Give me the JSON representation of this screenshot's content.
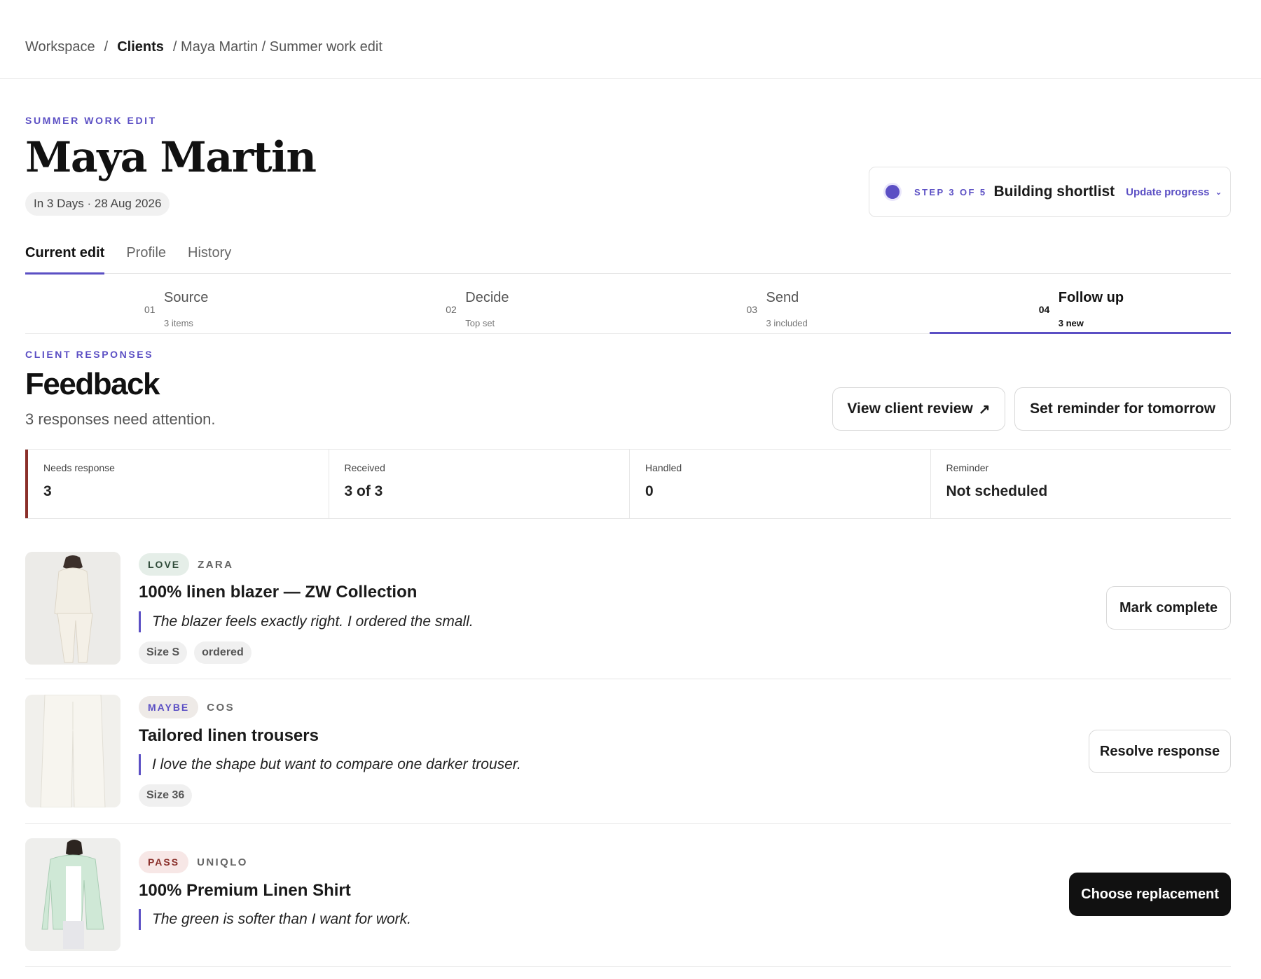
{
  "breadcrumb": {
    "workspace": "Workspace",
    "sep": "/",
    "clients": "Clients",
    "tail": "/ Maya Martin / Summer work edit"
  },
  "header": {
    "eyebrow": "SUMMER WORK EDIT",
    "client_name": "Maya Martin",
    "date_pill": "In 3 Days · 28 Aug 2026"
  },
  "progress": {
    "step_label": "STEP 3 OF 5",
    "title": "Building shortlist",
    "update_label": "Update progress",
    "accent": "#5b4fc4"
  },
  "tabs": [
    {
      "label": "Current edit",
      "active": true
    },
    {
      "label": "Profile",
      "active": false
    },
    {
      "label": "History",
      "active": false
    }
  ],
  "stepper": [
    {
      "num": "01",
      "name": "Source",
      "sub": "3 items"
    },
    {
      "num": "02",
      "name": "Decide",
      "sub": "Top set"
    },
    {
      "num": "03",
      "name": "Send",
      "sub": "3 included"
    },
    {
      "num": "04",
      "name": "Follow up",
      "sub": "3 new"
    }
  ],
  "feedback": {
    "eyebrow": "CLIENT RESPONSES",
    "title": "Feedback",
    "subtitle": "3 responses need attention.",
    "view_review_label": "View client review",
    "reminder_label": "Set reminder for tomorrow"
  },
  "stats": [
    {
      "label": "Needs response",
      "value": "3"
    },
    {
      "label": "Received",
      "value": "3 of 3"
    },
    {
      "label": "Handled",
      "value": "0"
    },
    {
      "label": "Reminder",
      "value": "Not scheduled"
    }
  ],
  "items": [
    {
      "tag": "LOVE",
      "brand": "ZARA",
      "title": "100% linen blazer — ZW Collection",
      "quote": "The blazer feels exactly right. I ordered the small.",
      "chips": [
        "Size S",
        "ordered"
      ],
      "action": "Mark complete"
    },
    {
      "tag": "MAYBE",
      "brand": "COS",
      "title": "Tailored linen trousers",
      "quote": "I love the shape but want to compare one darker trouser.",
      "chips": [
        "Size 36"
      ],
      "action": "Resolve response"
    },
    {
      "tag": "PASS",
      "brand": "UNIQLO",
      "title": "100% Premium Linen Shirt",
      "quote": "The green is softer than I want for work.",
      "chips": [],
      "action": "Choose replacement"
    }
  ],
  "colors": {
    "accent": "#5b4fc4",
    "love": "#2f4b39",
    "pass": "#8a2f2a",
    "primary_button": "#111111"
  }
}
